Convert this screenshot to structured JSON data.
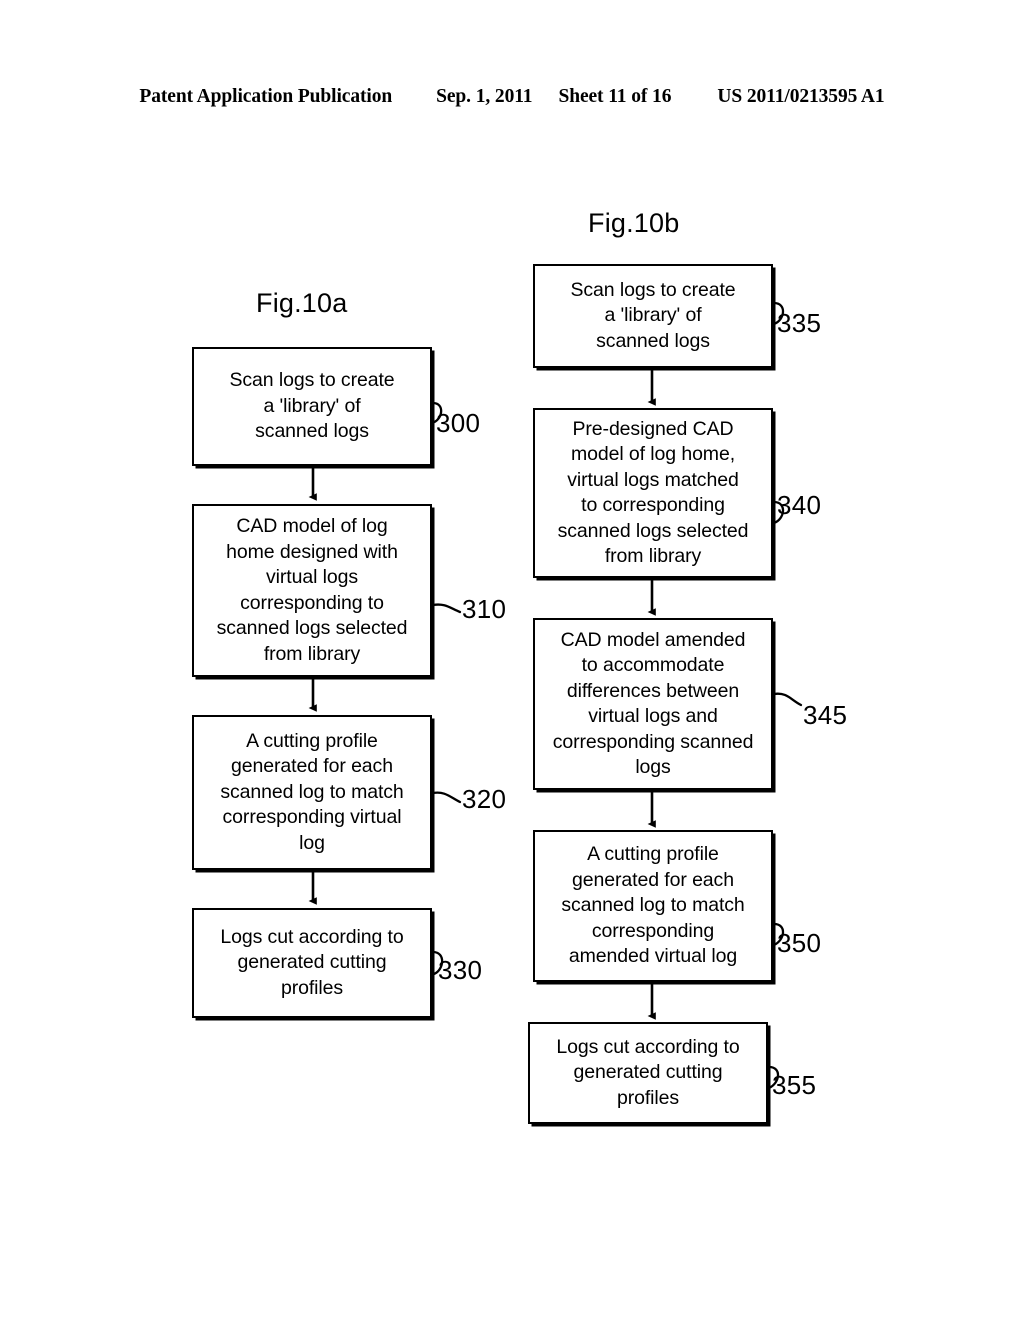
{
  "header": {
    "publication": "Patent Application Publication",
    "date": "Sep. 1, 2011",
    "sheet": "Sheet 11 of 16",
    "number": "US 2011/0213595 A1"
  },
  "figures": [
    {
      "title": "Fig.10a",
      "steps": [
        {
          "ref": "300",
          "text": "Scan logs to create\na 'library' of\nscanned logs"
        },
        {
          "ref": "310",
          "text": "CAD model of log\nhome designed with\nvirtual logs\ncorresponding to\nscanned logs selected\nfrom library"
        },
        {
          "ref": "320",
          "text": "A cutting profile\ngenerated for each\nscanned log to match\ncorresponding virtual\nlog"
        },
        {
          "ref": "330",
          "text": "Logs cut according to\ngenerated cutting\nprofiles"
        }
      ]
    },
    {
      "title": "Fig.10b",
      "steps": [
        {
          "ref": "335",
          "text": "Scan logs to create\na 'library' of\nscanned logs"
        },
        {
          "ref": "340",
          "text": "Pre-designed CAD\nmodel of log home,\nvirtual logs matched\nto corresponding\nscanned logs selected\nfrom library"
        },
        {
          "ref": "345",
          "text": "CAD model amended\nto accommodate\ndifferences between\nvirtual logs and\ncorresponding scanned\nlogs"
        },
        {
          "ref": "350",
          "text": "A cutting profile\ngenerated for each\nscanned log to match\ncorresponding\namended virtual log"
        },
        {
          "ref": "355",
          "text": "Logs cut according to\ngenerated cutting\nprofiles"
        }
      ]
    }
  ],
  "colors": {
    "ink": "#000000",
    "paper": "#ffffff"
  }
}
